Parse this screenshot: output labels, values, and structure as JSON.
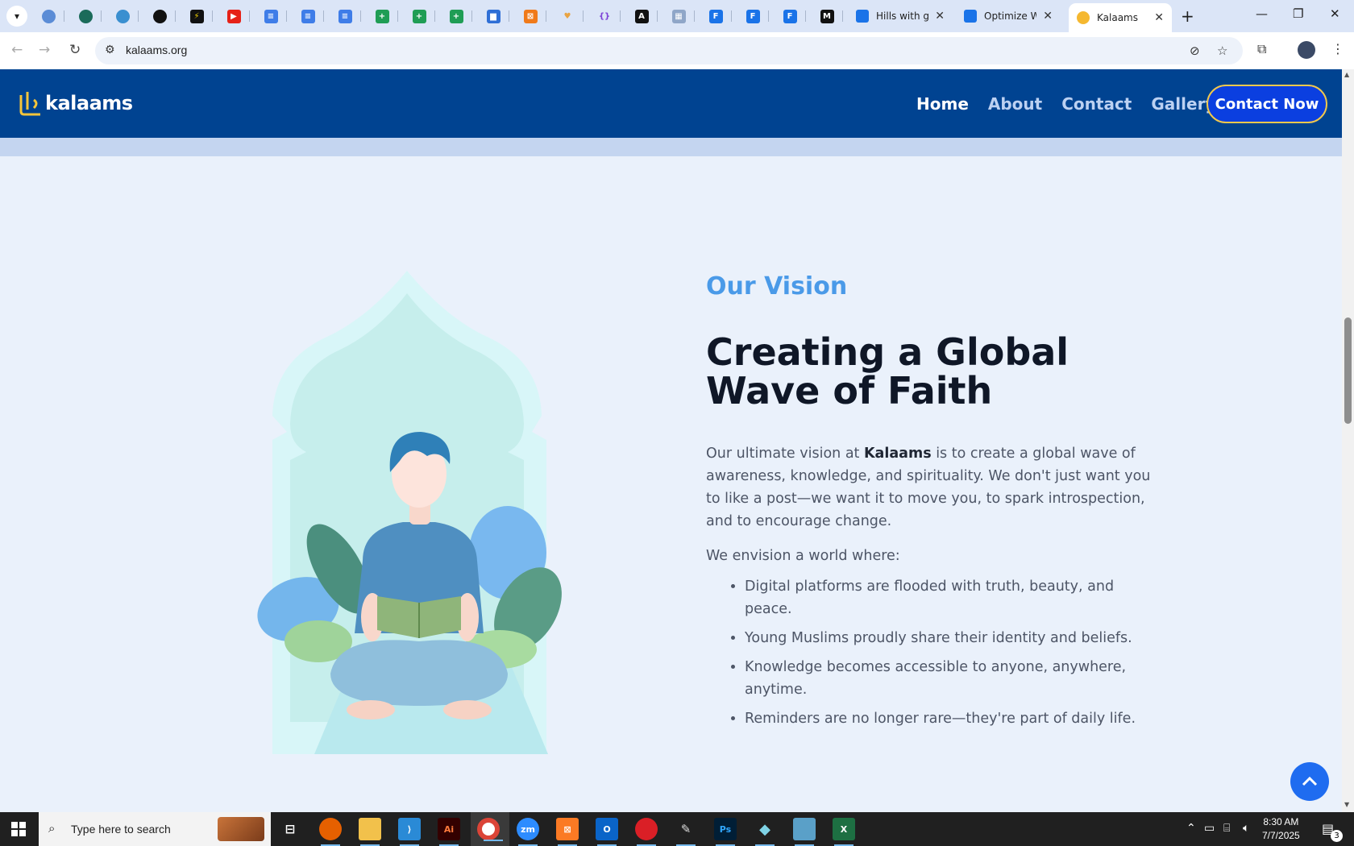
{
  "browser": {
    "tabs": [
      {
        "title": "Hills with gr",
        "close": "✕"
      },
      {
        "title": "Optimize W",
        "close": "✕"
      },
      {
        "title": "Kalaams",
        "close": "✕"
      }
    ],
    "new_tab": "+",
    "url": "kalaams.org",
    "window": {
      "minimize": "—",
      "restore": "❐",
      "close": "✕"
    }
  },
  "site": {
    "logo_text": "kalaams",
    "nav": [
      {
        "label": "Home"
      },
      {
        "label": "About"
      },
      {
        "label": "Contact"
      },
      {
        "label": "Gallery"
      }
    ],
    "cta_label": "Contact Now",
    "accent": "#004391"
  },
  "vision": {
    "label": "Our Vision",
    "title": "Creating a Global Wave of Faith",
    "para_pre": "Our ultimate vision at ",
    "para_brand": "Kalaams",
    "para_post": " is to create a global wave of awareness, knowledge, and spirituality. We don't just want you to like a post—we want it to move you, to spark introspection, and to encourage change.",
    "intro": "We envision a world where:",
    "items": [
      "Digital platforms are flooded with truth, beauty, and peace.",
      "Young Muslims proudly share their identity and beliefs.",
      "Knowledge becomes accessible to anyone, anywhere, anytime.",
      "Reminders are no longer rare—they're part of daily life."
    ]
  },
  "taskbar": {
    "search_placeholder": "Type here to search",
    "time": "8:30 AM",
    "date": "7/7/2025",
    "notifications": "3"
  }
}
